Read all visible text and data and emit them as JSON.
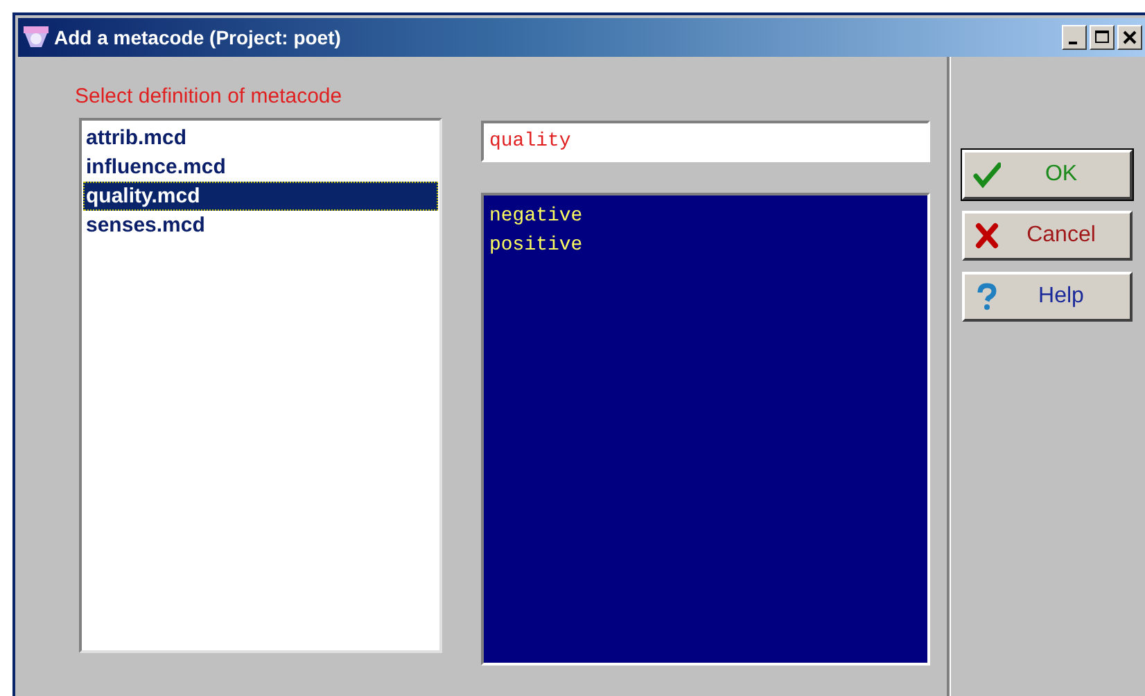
{
  "window": {
    "title": "Add a metacode (Project: poet)"
  },
  "definition_label": "Select definition of metacode",
  "files": [
    {
      "name": "attrib.mcd",
      "selected": false
    },
    {
      "name": "influence.mcd",
      "selected": false
    },
    {
      "name": "quality.mcd",
      "selected": true
    },
    {
      "name": "senses.mcd",
      "selected": false
    }
  ],
  "metacode_field": {
    "value": "quality"
  },
  "values": [
    "negative",
    "positive"
  ],
  "buttons": [
    {
      "kind": "ok",
      "label": "OK",
      "default": true
    },
    {
      "kind": "cancel",
      "label": "Cancel",
      "default": false
    },
    {
      "kind": "help",
      "label": "Help",
      "default": false
    }
  ]
}
